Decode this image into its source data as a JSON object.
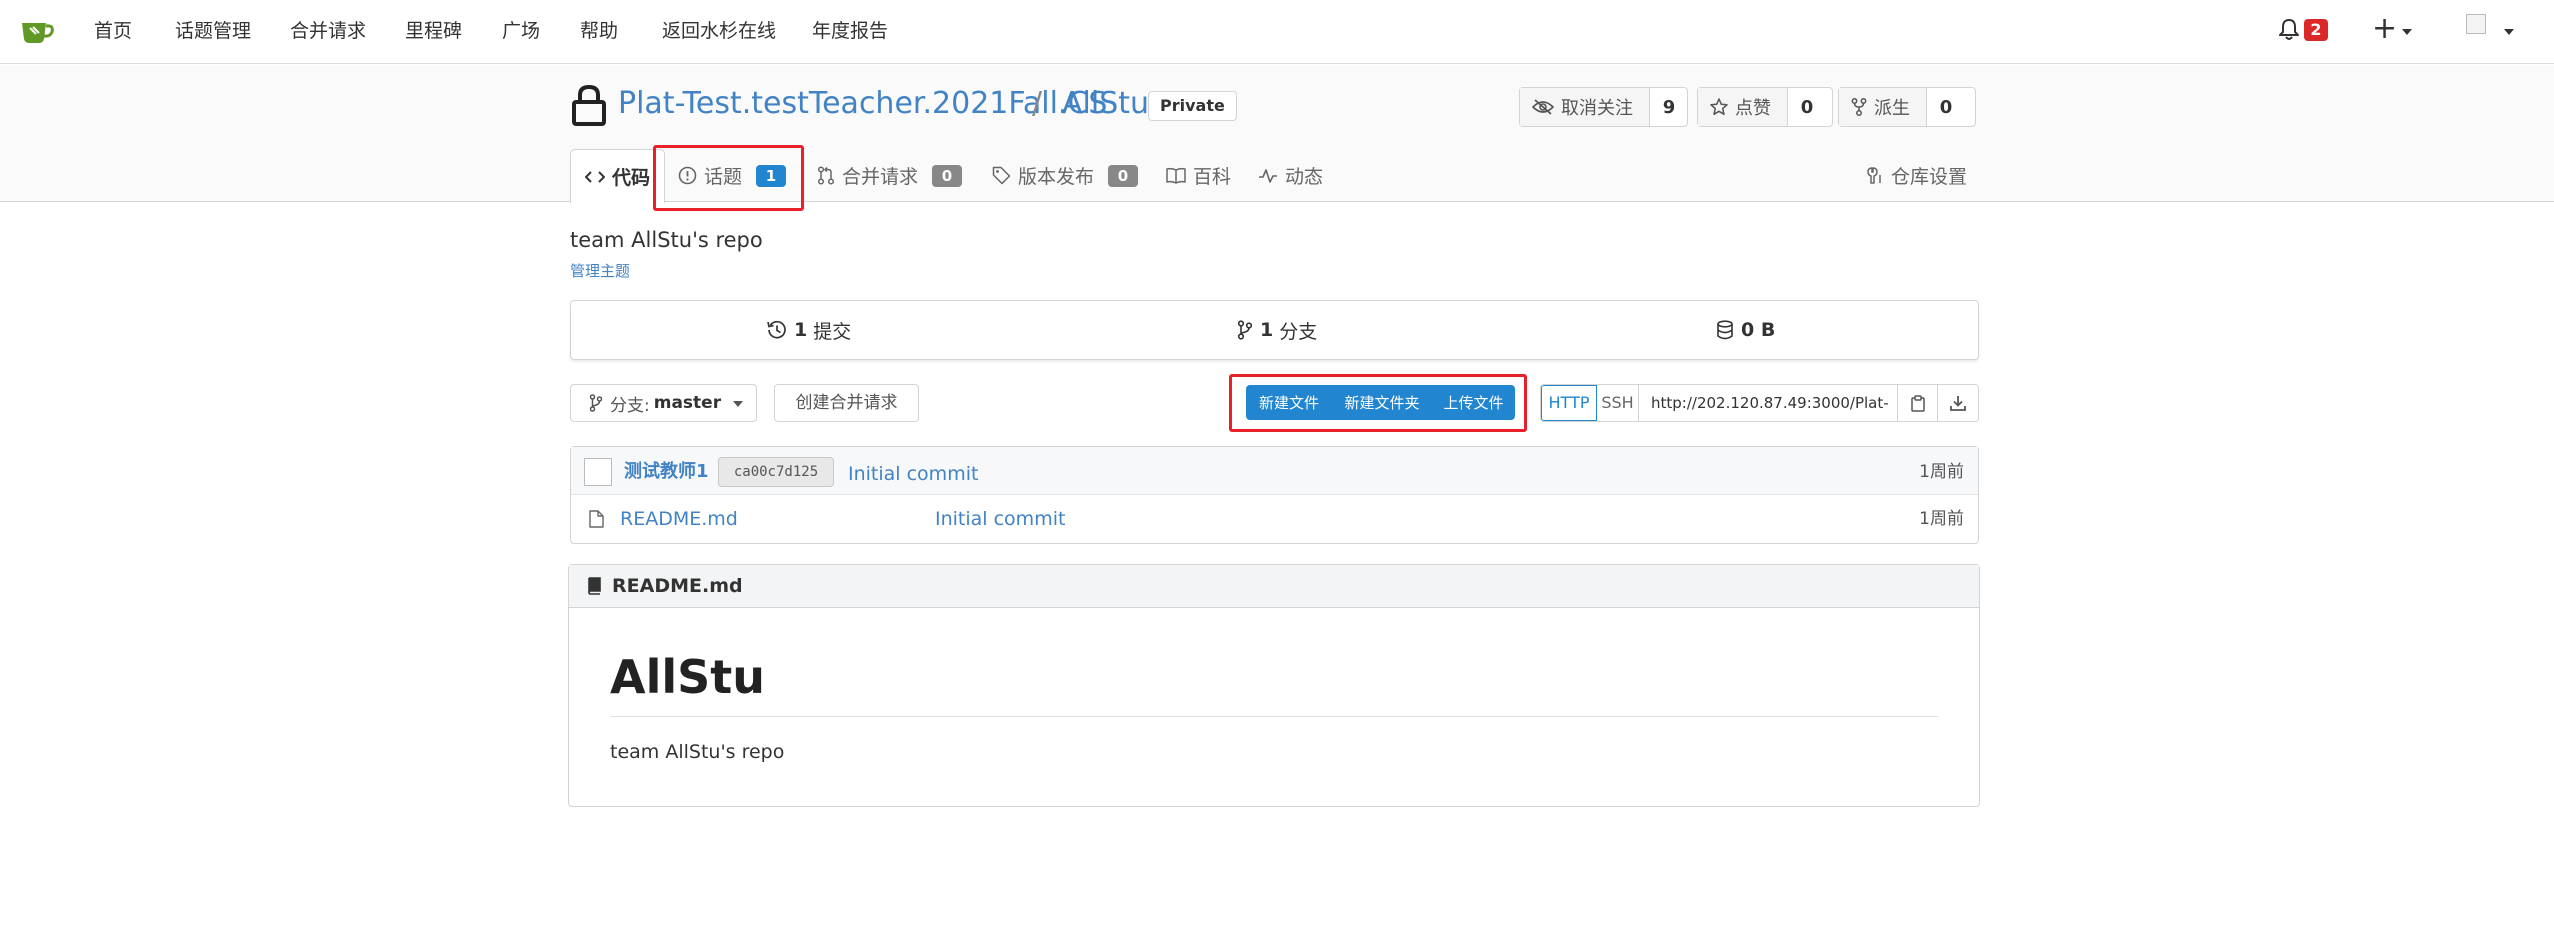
{
  "nav": {
    "links": [
      "首页",
      "话题管理",
      "合并请求",
      "里程碑",
      "广场",
      "帮助",
      "返回水杉在线",
      "年度报告"
    ],
    "notification_count": "2",
    "plus": "+"
  },
  "repo": {
    "owner": "Plat-Test.testTeacher.2021Fall.CS",
    "separator": "/",
    "name": "AllStu",
    "visibility": "Private",
    "watch_label": "取消关注",
    "watch_count": "9",
    "star_label": "点赞",
    "star_count": "0",
    "fork_label": "派生",
    "fork_count": "0"
  },
  "tabs": {
    "code": "代码",
    "issues": "话题",
    "issues_count": "1",
    "pulls": "合并请求",
    "pulls_count": "0",
    "releases": "版本发布",
    "releases_count": "0",
    "wiki": "百科",
    "activity": "动态",
    "settings": "仓库设置"
  },
  "description": "team AllStu's repo",
  "manage_topics": "管理主题",
  "stats": {
    "commits_count": "1",
    "commits_label": "提交",
    "branches_count": "1",
    "branches_label": "分支",
    "size": "0 B"
  },
  "toolbar": {
    "branch_prefix": "分支:",
    "branch_name": "master",
    "new_pr": "创建合并请求",
    "new_file": "新建文件",
    "new_folder": "新建文件夹",
    "upload_file": "上传文件",
    "http": "HTTP",
    "ssh": "SSH",
    "clone_url": "http://202.120.87.49:3000/Plat-"
  },
  "latest_commit": {
    "author": "测试教师1",
    "sha": "ca00c7d125",
    "message": "Initial commit",
    "time": "1周前"
  },
  "files": [
    {
      "name": "README.md",
      "message": "Initial commit",
      "time": "1周前"
    }
  ],
  "readme": {
    "filename": "README.md",
    "heading": "AllStu",
    "body": "team AllStu's repo"
  },
  "colors": {
    "link": "#4183c4",
    "primary": "#2185d0",
    "danger": "#db2828",
    "highlight_box": "#e8202a"
  }
}
